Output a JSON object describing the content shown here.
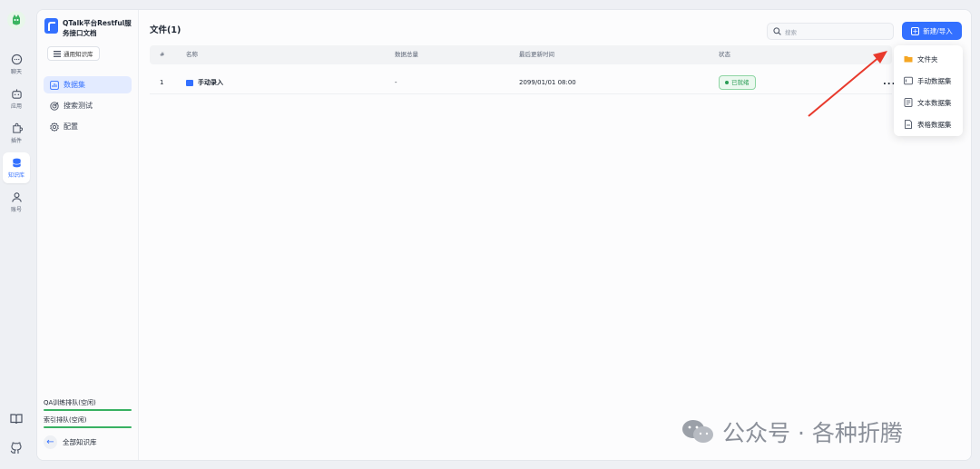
{
  "rail": {
    "items": [
      {
        "label": "聊天",
        "icon": "chat-icon"
      },
      {
        "label": "应用",
        "icon": "robot-icon"
      },
      {
        "label": "插件",
        "icon": "puzzle-icon"
      },
      {
        "label": "知识库",
        "icon": "database-icon",
        "active": true
      },
      {
        "label": "账号",
        "icon": "user-icon"
      }
    ]
  },
  "sidebar": {
    "kb_name": "QTalk平台Restful服务接口文档",
    "kb_type": "通用知识库",
    "nav": [
      {
        "label": "数据集",
        "active": true
      },
      {
        "label": "搜索测试"
      },
      {
        "label": "配置"
      }
    ],
    "queues": [
      "QA训练排队(空闲)",
      "索引排队(空闲)"
    ],
    "back_label": "全部知识库"
  },
  "main": {
    "title": "文件(1)",
    "search_placeholder": "搜索",
    "new_button": "新建/导入",
    "columns": [
      "#",
      "名称",
      "数据总量",
      "最后更新时间",
      "状态"
    ],
    "rows": [
      {
        "index": "1",
        "name": "手动录入",
        "total": "-",
        "updated": "2099/01/01 08:00",
        "status": "已就绪"
      }
    ],
    "more": "..."
  },
  "menu": {
    "items": [
      "文件夹",
      "手动数据集",
      "文本数据集",
      "表格数据集"
    ]
  },
  "watermark": "公众号 · 各种折腾",
  "colors": {
    "accent": "#3370ff",
    "success": "#2b9c55",
    "arrow": "#e8392c"
  }
}
